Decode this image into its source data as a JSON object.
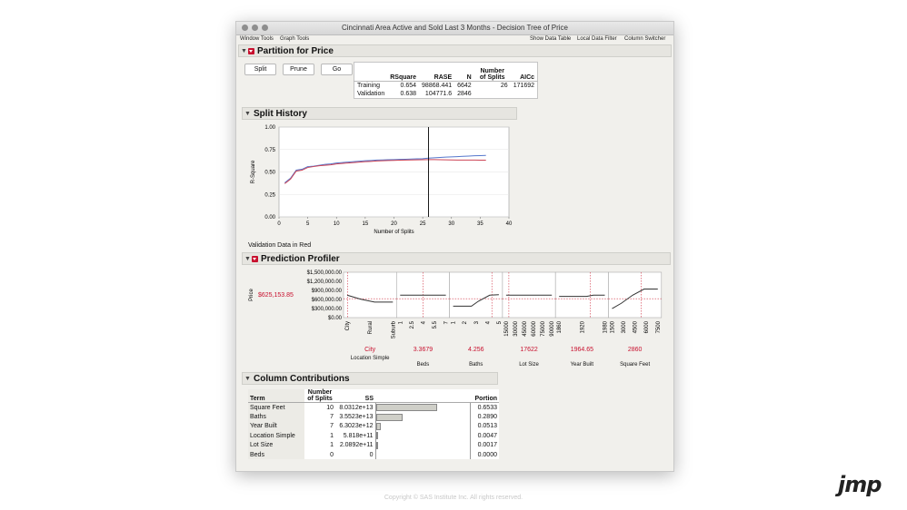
{
  "window": {
    "title": "Cincinnati Area Active and Sold Last 3 Months - Decision Tree of Price"
  },
  "menus": {
    "left": [
      "Window Tools",
      "Graph Tools"
    ],
    "right": [
      "Show Data Table",
      "Local Data Filter",
      "Column Switcher"
    ]
  },
  "partition": {
    "title": "Partition for Price",
    "buttons": [
      "Split",
      "Prune",
      "Go"
    ],
    "fit_headers": [
      "RSquare",
      "RASE",
      "N",
      "Number of Splits",
      "AICc"
    ],
    "rows": [
      {
        "label": "Training",
        "rsquare": "0.654",
        "rase": "98868.441",
        "n": "6642",
        "splits": "26",
        "aicc": "171692"
      },
      {
        "label": "Validation",
        "rsquare": "0.638",
        "rase": "104771.6",
        "n": "2846",
        "splits": "",
        "aicc": ""
      }
    ]
  },
  "split_history": {
    "title": "Split History",
    "note": "Validation Data in Red",
    "colors": {
      "training": "#5577cc",
      "validation": "#cc4455"
    },
    "chart_data": {
      "type": "line",
      "xlabel": "Number of Splits",
      "ylabel": "R-Square",
      "xlim": [
        0,
        40
      ],
      "ylim": [
        0,
        1
      ],
      "xticks": [
        "0",
        "5",
        "10",
        "15",
        "20",
        "25",
        "30",
        "35",
        "40"
      ],
      "yticks": [
        "0.00",
        "0.25",
        "0.50",
        "0.75",
        "1.00"
      ],
      "current_split": 26,
      "x": [
        1,
        2,
        3,
        4,
        5,
        6,
        7,
        8,
        9,
        10,
        11,
        12,
        13,
        14,
        15,
        16,
        17,
        18,
        19,
        20,
        21,
        22,
        23,
        24,
        25,
        26,
        27,
        28,
        29,
        30,
        31,
        32,
        33,
        34,
        35,
        36
      ],
      "series": [
        {
          "values": [
            0.38,
            0.43,
            0.52,
            0.53,
            0.56,
            0.565,
            0.575,
            0.585,
            0.59,
            0.6,
            0.605,
            0.61,
            0.615,
            0.62,
            0.625,
            0.628,
            0.632,
            0.634,
            0.636,
            0.638,
            0.64,
            0.642,
            0.644,
            0.646,
            0.648,
            0.654,
            0.658,
            0.662,
            0.665,
            0.668,
            0.671,
            0.674,
            0.677,
            0.68,
            0.682,
            0.684
          ]
        },
        {
          "values": [
            0.37,
            0.42,
            0.51,
            0.52,
            0.55,
            0.56,
            0.57,
            0.575,
            0.58,
            0.59,
            0.595,
            0.6,
            0.605,
            0.61,
            0.615,
            0.618,
            0.622,
            0.625,
            0.627,
            0.629,
            0.631,
            0.633,
            0.634,
            0.635,
            0.636,
            0.638,
            0.637,
            0.636,
            0.635,
            0.634,
            0.633,
            0.633,
            0.632,
            0.632,
            0.631,
            0.631
          ]
        }
      ]
    }
  },
  "profiler": {
    "title": "Prediction Profiler",
    "ylabel": "Price",
    "current_value": "$625,153.85",
    "yticks": [
      "$1,500,000.00",
      "$1,200,000.00",
      "$900,000.00",
      "$600,000.00",
      "$300,000.00",
      "$0.00"
    ],
    "factors": [
      {
        "value": "City",
        "label": "Location Simple",
        "ticks": [
          "City",
          "Rural",
          "Suburb"
        ]
      },
      {
        "value": "3.3679",
        "label": "Beds",
        "ticks": [
          "1",
          "2.5",
          "4",
          "5.5",
          "7"
        ]
      },
      {
        "value": "4.256",
        "label": "Baths",
        "ticks": [
          "1",
          "2",
          "3",
          "4",
          "5"
        ]
      },
      {
        "value": "17622",
        "label": "Lot Size",
        "ticks": [
          "15000",
          "30000",
          "45000",
          "60000",
          "75000",
          "90000"
        ]
      },
      {
        "value": "1964.65",
        "label": "Year Built",
        "ticks": [
          "1860",
          "1920",
          "1980"
        ]
      },
      {
        "value": "2860",
        "label": "Square Feet",
        "ticks": [
          "1500",
          "3000",
          "4500",
          "6000",
          "7500"
        ]
      }
    ]
  },
  "contributions": {
    "title": "Column Contributions",
    "headers": {
      "term": "Term",
      "splits": "Number of Splits",
      "ss": "SS",
      "portion": "Portion"
    },
    "rows": [
      {
        "term": "Square Feet",
        "splits": "10",
        "ss": "8.0312e+13",
        "portion": "0.6533",
        "frac": 0.6533
      },
      {
        "term": "Baths",
        "splits": "7",
        "ss": "3.5523e+13",
        "portion": "0.2890",
        "frac": 0.289
      },
      {
        "term": "Year Built",
        "splits": "7",
        "ss": "6.3023e+12",
        "portion": "0.0513",
        "frac": 0.0513
      },
      {
        "term": "Location Simple",
        "splits": "1",
        "ss": "5.818e+11",
        "portion": "0.0047",
        "frac": 0.0047
      },
      {
        "term": "Lot Size",
        "splits": "1",
        "ss": "2.0892e+11",
        "portion": "0.0017",
        "frac": 0.0017
      },
      {
        "term": "Beds",
        "splits": "0",
        "ss": "0",
        "portion": "0.0000",
        "frac": 0
      }
    ]
  },
  "footer": {
    "copyright": "Copyright © SAS Institute Inc. All rights reserved.",
    "logo": "jmp"
  }
}
